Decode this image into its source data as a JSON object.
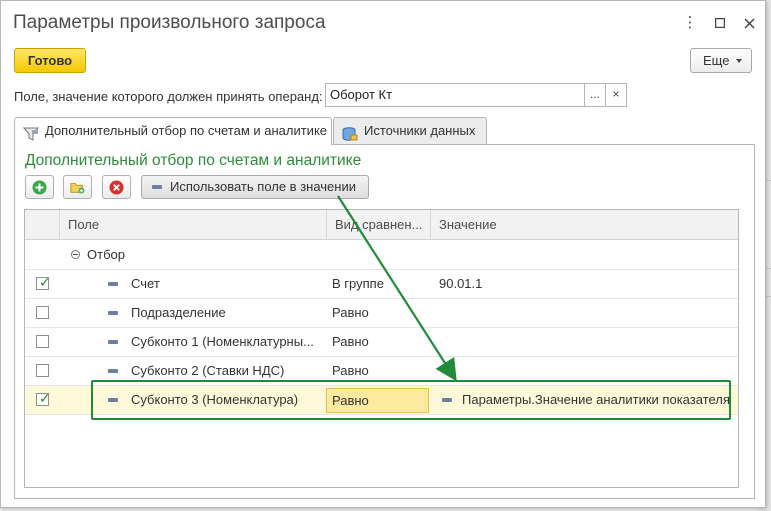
{
  "window": {
    "title": "Параметры произвольного запроса",
    "controls": {
      "more_glyph": "⋮",
      "maximize_glyph": "☐",
      "close_glyph": "✕"
    }
  },
  "toolbar": {
    "ready_label": "Готово",
    "more_label": "Еще"
  },
  "operand": {
    "label": "Поле, значение которого должен принять операнд:",
    "value": "Оборот Кт",
    "select_btn": "...",
    "clear_btn": "×"
  },
  "tabs": [
    {
      "label": "Дополнительный отбор по счетам и аналитике",
      "icon": "filter-icon",
      "active": true
    },
    {
      "label": "Источники данных",
      "icon": "data-sources-icon",
      "active": false
    }
  ],
  "section": {
    "title": "Дополнительный отбор по счетам и аналитике",
    "use_field_button": "Использовать поле в значении"
  },
  "colors": {
    "accent_green": "#2e8b3a",
    "ready_button": "#f5c800",
    "highlight_row": "#fff9d9",
    "callout_box": "#218b3b"
  },
  "grid": {
    "columns": [
      "Поле",
      "Вид сравнен...",
      "Значение"
    ],
    "group_label": "Отбор",
    "rows": [
      {
        "checked": true,
        "field": "Счет",
        "comparison": "В группе",
        "value": "90.01.1"
      },
      {
        "checked": false,
        "field": "Подразделение",
        "comparison": "Равно",
        "value": ""
      },
      {
        "checked": false,
        "field": "Субконто 1 (Номенклатурны...",
        "comparison": "Равно",
        "value": ""
      },
      {
        "checked": false,
        "field": "Субконто 2 (Ставки НДС)",
        "comparison": "Равно",
        "value": ""
      },
      {
        "checked": true,
        "field": "Субконто 3 (Номенклатура)",
        "comparison": "Равно",
        "value": "Параметры.Значение аналитики показателя",
        "selected": true
      }
    ]
  }
}
